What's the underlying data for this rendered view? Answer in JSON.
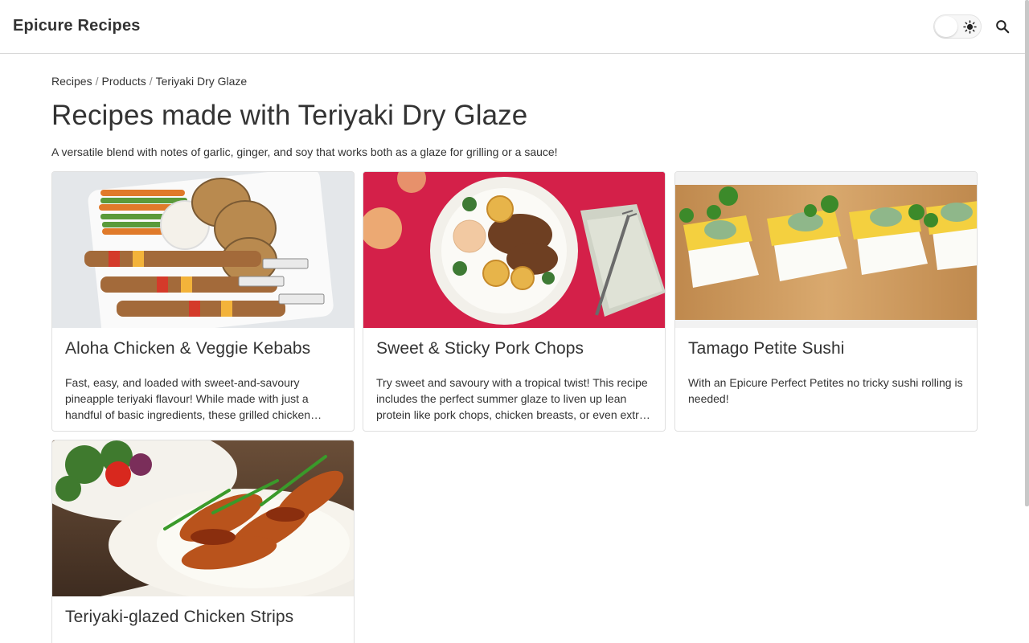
{
  "header": {
    "site_title": "Epicure Recipes",
    "theme_toggle_icon": "sun-icon",
    "search_icon": "search-icon"
  },
  "breadcrumb": {
    "items": [
      "Recipes",
      "Products",
      "Teriyaki Dry Glaze"
    ],
    "separator": "/"
  },
  "main": {
    "title": "Recipes made with Teriyaki Dry Glaze",
    "description": "A versatile blend with notes of garlic, ginger, and soy that works both as a glaze for grilling or a sauce!",
    "recipes": [
      {
        "title": "Aloha Chicken & Veggie Kebabs",
        "excerpt": "Fast, easy, and loaded with sweet-and-savoury pineapple teriyaki flavour! While made with just a handful of basic ingredients, these grilled chicken…"
      },
      {
        "title": "Sweet & Sticky Pork Chops",
        "excerpt": "Try sweet and savoury with a tropical twist! This recipe includes the perfect summer glaze to liven up lean protein like pork chops, chicken breasts, or even extr…"
      },
      {
        "title": "Tamago Petite Sushi",
        "excerpt": "With an Epicure Perfect Petites no tricky sushi rolling is needed!"
      },
      {
        "title": "Teriyaki-glazed Chicken Strips",
        "excerpt": ""
      }
    ]
  },
  "colors": {
    "text": "#333333",
    "border": "#e0e0e0",
    "pork_background": "#d42049"
  }
}
